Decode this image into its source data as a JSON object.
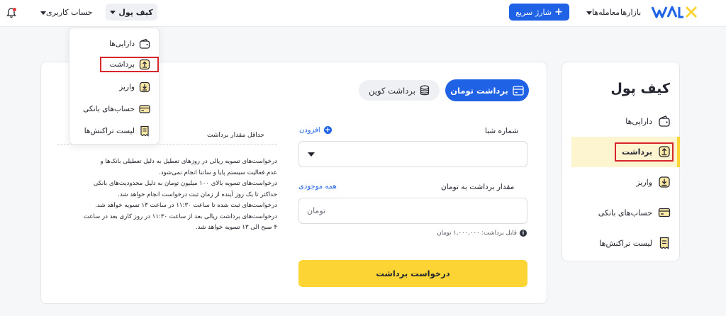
{
  "header": {
    "brand": "WALLEX",
    "nav_markets": "بازارها",
    "nav_trades": "معامله‌ها",
    "quick_charge": "شارژ سریع",
    "wallet_menu": "کیف پول",
    "account_menu": "حساب کاربری"
  },
  "dropdown": {
    "items": [
      "دارایی‌ها",
      "برداشت",
      "واریز",
      "حساب‌های بانکی",
      "لیست تراکنش‌ها"
    ],
    "active_index": 1
  },
  "main": {
    "tab_toman": "برداشت تومان",
    "tab_coin": "برداشت کوین",
    "sheba_label": "شماره شبا",
    "sheba_add": "افزودن",
    "amount_label": "مقدار برداشت به تومان",
    "all_balance": "همه موجودی",
    "amount_placeholder": "تومان",
    "withdrawable": "قابل برداشت: ۱,۰۰۰,۰۰۰ تومان",
    "submit": "درخواست برداشت",
    "min_withdraw_label": "حداقل مقدار برداشت",
    "notes": [
      "درخواست‌های تسویه ریالی در روزهای تعطیل به دلیل تعطیلی بانک‌ها و",
      "عدم فعالیت سیستم پایا و ساتنا انجام نمی‌شود.",
      "درخواست‌های تسویه بالای ۱۰۰ میلیون تومان به دلیل محدودیت‌های بانکی",
      "حداکثر تا یک روز آینده از زمان ثبت درخواست انجام خواهد شد.",
      "درخواست‌های ثبت شده تا ساعت ۱۱:۳۰ در ساعت ۱۳ تسویه خواهد شد.",
      "درخواست‌های برداشت ریالی بعد از ساعت ۱۱:۳۰ در روز کاری بعد در ساعت",
      "۴ صبح الی ۱۳ تسویه خواهد شد."
    ]
  },
  "sidebar": {
    "title": "کیف پول",
    "items": [
      "دارایی‌ها",
      "برداشت",
      "واریز",
      "حساب‌های بانکی",
      "لیست تراکنش‌ها"
    ],
    "active_index": 1
  },
  "colors": {
    "primary_blue": "#1f62e6",
    "accent_yellow": "#fcd535",
    "highlight_red": "#d8262d",
    "active_bg": "#fdf4d0"
  },
  "icons": {
    "bell": "bell-icon",
    "assets": "wallet-icon",
    "withdraw": "upload-icon",
    "deposit": "download-icon",
    "bank": "card-icon",
    "transactions": "receipt-icon",
    "coin": "coins-icon"
  }
}
